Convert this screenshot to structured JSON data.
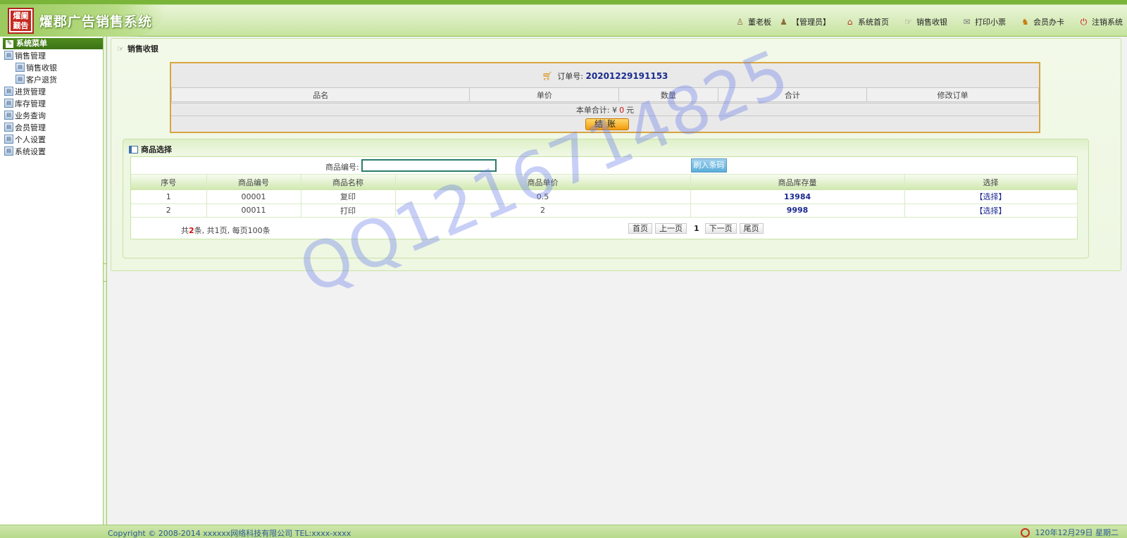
{
  "app": {
    "logo_lines": [
      "燿阑",
      "觐告"
    ],
    "title": "燿郡广告销售系统"
  },
  "top_nav": [
    {
      "icon": "user-icon",
      "label": "董老板"
    },
    {
      "icon": "users-icon",
      "label": "【管理员】"
    },
    {
      "icon": "home-icon",
      "label": "系统首页"
    },
    {
      "icon": "hand-icon",
      "label": "销售收银"
    },
    {
      "icon": "print-icon",
      "label": "打印小票"
    },
    {
      "icon": "member-card-icon",
      "label": "会员办卡"
    },
    {
      "icon": "logout-icon",
      "label": "注销系统"
    }
  ],
  "sidebar": {
    "title": "系统菜单",
    "items": [
      {
        "label": "销售管理",
        "level": 0
      },
      {
        "label": "销售收银",
        "level": 1
      },
      {
        "label": "客户退货",
        "level": 1
      },
      {
        "label": "进货管理",
        "level": 0
      },
      {
        "label": "库存管理",
        "level": 0
      },
      {
        "label": "业务查询",
        "level": 0
      },
      {
        "label": "会员管理",
        "level": 0
      },
      {
        "label": "个人设置",
        "level": 0
      },
      {
        "label": "系统设置",
        "level": 0
      }
    ]
  },
  "panel": {
    "title": "销售收银"
  },
  "order": {
    "order_no_label": "订单号:",
    "order_no": "20201229191153",
    "columns": [
      "品名",
      "单价",
      "数量",
      "合计",
      "修改订单"
    ],
    "total_label": "本单合计: ¥",
    "total_value": "0",
    "total_unit": "元",
    "checkout_label": "结账"
  },
  "product_select": {
    "title": "商品选择",
    "search_label": "商品编号:",
    "search_value": "",
    "barcode_button": "刷入条码",
    "columns": [
      "序号",
      "商品编号",
      "商品名称",
      "商品单价",
      "商品库存量",
      "选择"
    ],
    "rows": [
      {
        "no": "1",
        "code": "00001",
        "name": "复印",
        "price": "0.5",
        "stock": "13984",
        "action": "【选择】"
      },
      {
        "no": "2",
        "code": "00011",
        "name": "打印",
        "price": "2",
        "stock": "9998",
        "action": "【选择】"
      }
    ],
    "pager": {
      "prefix": "共",
      "total": "2",
      "suffix": "条, 共1页, 每页100条",
      "first": "首页",
      "prev": "上一页",
      "current": "1",
      "next": "下一页",
      "last": "尾页"
    }
  },
  "watermark": "QQ1216714825",
  "footer": {
    "copyright": "Copyright © 2008-2014 xxxxxx网络科技有限公司 TEL:xxxx-xxxx",
    "date": "120年12月29日 星期二"
  },
  "colors": {
    "header_green": "#7ab53a",
    "sidebar_head": "#3c7314",
    "order_border": "#d9a441",
    "link_blue": "#1a2a8f",
    "accent_red": "#d01010"
  }
}
